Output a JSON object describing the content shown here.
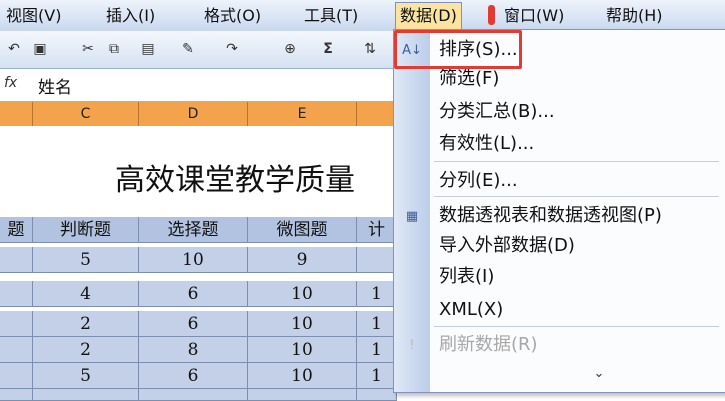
{
  "menubar": {
    "items": [
      {
        "label": "视图(V)"
      },
      {
        "label": "插入(I)"
      },
      {
        "label": "格式(O)"
      },
      {
        "label": "工具(T)"
      },
      {
        "label": "数据(D)"
      },
      {
        "label": "窗口(W)"
      },
      {
        "label": "帮助(H)"
      }
    ]
  },
  "toolbar": {
    "icons": [
      "undo-icon",
      "save-icon",
      "cut-icon",
      "copy-icon",
      "paste-icon",
      "format-painter-icon",
      "redo-icon",
      "hyperlink-icon",
      "autosum-icon",
      "sort-ascending-icon"
    ],
    "sigma": "Σ"
  },
  "formula_bar": {
    "fx": "fx",
    "value": "姓名"
  },
  "columns": [
    "C",
    "D",
    "E"
  ],
  "sheet": {
    "title": "高效课堂教学质量",
    "headers": [
      "题",
      "判断题",
      "选择题",
      "微图题",
      "计"
    ],
    "rows": [
      [
        "",
        "5",
        "10",
        "9",
        ""
      ],
      [
        "",
        "4",
        "6",
        "10",
        "1"
      ],
      [
        "",
        "2",
        "6",
        "10",
        "1"
      ],
      [
        "",
        "2",
        "8",
        "10",
        "1"
      ],
      [
        "",
        "5",
        "6",
        "10",
        "1"
      ]
    ]
  },
  "data_menu": {
    "items": [
      {
        "label": "排序(S)...",
        "icon": "sort-icon"
      },
      {
        "label": "筛选(F)"
      },
      {
        "label": "分类汇总(B)..."
      },
      {
        "label": "有效性(L)..."
      },
      {
        "label": "分列(E)..."
      },
      {
        "label": "数据透视表和数据透视图(P)",
        "icon": "pivot-table-icon"
      },
      {
        "label": "导入外部数据(D)"
      },
      {
        "label": "列表(I)"
      },
      {
        "label": "XML(X)"
      },
      {
        "label": "刷新数据(R)",
        "icon": "refresh-icon",
        "disabled": true
      }
    ],
    "expand_icon": "double-chevron-down-icon"
  },
  "colors": {
    "highlight": "#e23b33",
    "column_header": "#f3a34c",
    "grid_cell": "#c3d0e8",
    "menu_active": "#fbe3a0"
  }
}
